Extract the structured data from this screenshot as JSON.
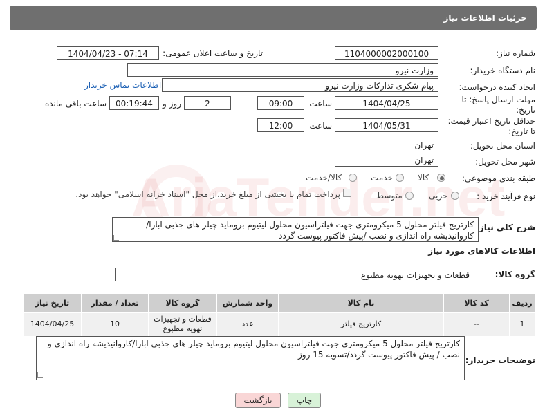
{
  "header": {
    "title": "جزئیات اطلاعات نیاز"
  },
  "watermark": {
    "text": "AriaTender.net"
  },
  "fields": {
    "need_number": {
      "label": "شماره نیاز:",
      "value": "1104000002000100"
    },
    "announce_datetime": {
      "label": "تاریخ و ساعت اعلان عمومی:",
      "value": "1404/04/23 - 07:14"
    },
    "buyer_org": {
      "label": "نام دستگاه خریدار:",
      "value": "وزارت نیرو"
    },
    "requester": {
      "label": "ایجاد کننده درخواست:",
      "value": "پیام شکری تدارکات وزارت نیرو",
      "contact_link": "اطلاعات تماس خریدار"
    },
    "response_deadline": {
      "label_line1": "مهلت ارسال پاسخ: تا",
      "label_line2": "تاریخ:",
      "date": "1404/04/25",
      "time_label": "ساعت",
      "time": "09:00",
      "days": "2",
      "days_label": "روز و",
      "remaining": "00:19:44",
      "remaining_label": "ساعت باقی مانده"
    },
    "price_validity": {
      "label_line1": "حداقل تاریخ اعتبار قیمت:",
      "label_line2": "تا تاریخ:",
      "date": "1404/05/31",
      "time_label": "ساعت",
      "time": "12:00"
    },
    "delivery_province": {
      "label": "استان محل تحویل:",
      "value": "تهران"
    },
    "delivery_city": {
      "label": "شهر محل تحویل:",
      "value": "تهران"
    },
    "category": {
      "label": "طبقه بندی موضوعی:",
      "options": [
        {
          "label": "کالا",
          "selected": true
        },
        {
          "label": "خدمت",
          "selected": false
        },
        {
          "label": "کالا/خدمت",
          "selected": false
        }
      ]
    },
    "purchase_process": {
      "label": "نوع فرآیند خرید :",
      "options": [
        {
          "label": "جزیی",
          "selected": false
        },
        {
          "label": "متوسط",
          "selected": false
        }
      ],
      "payment_note": "پرداخت تمام یا بخشی از مبلغ خرید،از محل \"اسناد خزانه اسلامی\" خواهد بود."
    }
  },
  "general_description": {
    "label": "شرح کلی نیاز:",
    "text": "کارتریج فیلتر محلول 5 میکرومتری جهت فیلتراسیون محلول لیتیوم بروماید چیلر های جذبی ابارا/کاروانیدیشه راه اندازی و نصب /پیش فاکتور پیوست گردد"
  },
  "goods_info": {
    "section_title": "اطلاعات کالاهای مورد نیاز",
    "group_label": "گروه کالا:",
    "group_value": "قطعات و تجهیزات تهویه مطبوع"
  },
  "table": {
    "headers": [
      "ردیف",
      "کد کالا",
      "نام کالا",
      "واحد شمارش",
      "گروه کالا",
      "تعداد / مقدار",
      "تاریخ نیاز"
    ],
    "rows": [
      [
        "1",
        "--",
        "کارتریج فیلتر",
        "عدد",
        "قطعات و تجهیزات تهویه مطبوع",
        "10",
        "1404/04/25"
      ]
    ]
  },
  "buyer_notes": {
    "label": "توضیحات خریدار:",
    "text": "کارتریج فیلتر محلول 5 میکرومتری جهت فیلتراسیون محلول لیتیوم بروماید چیلر های جذبی ابارا/کاروانیدیشه راه اندازی و نصب / پیش فاکتور پیوست گردد/تسویه 15 روز"
  },
  "buttons": {
    "print": "چاپ",
    "back": "بازگشت"
  },
  "colors": {
    "header_bg": "#6f6f6f",
    "link": "#1a5fb4",
    "table_header": "#cfcfcf",
    "back_button": "#f9d6d6",
    "print_button": "#d8f2d8"
  }
}
